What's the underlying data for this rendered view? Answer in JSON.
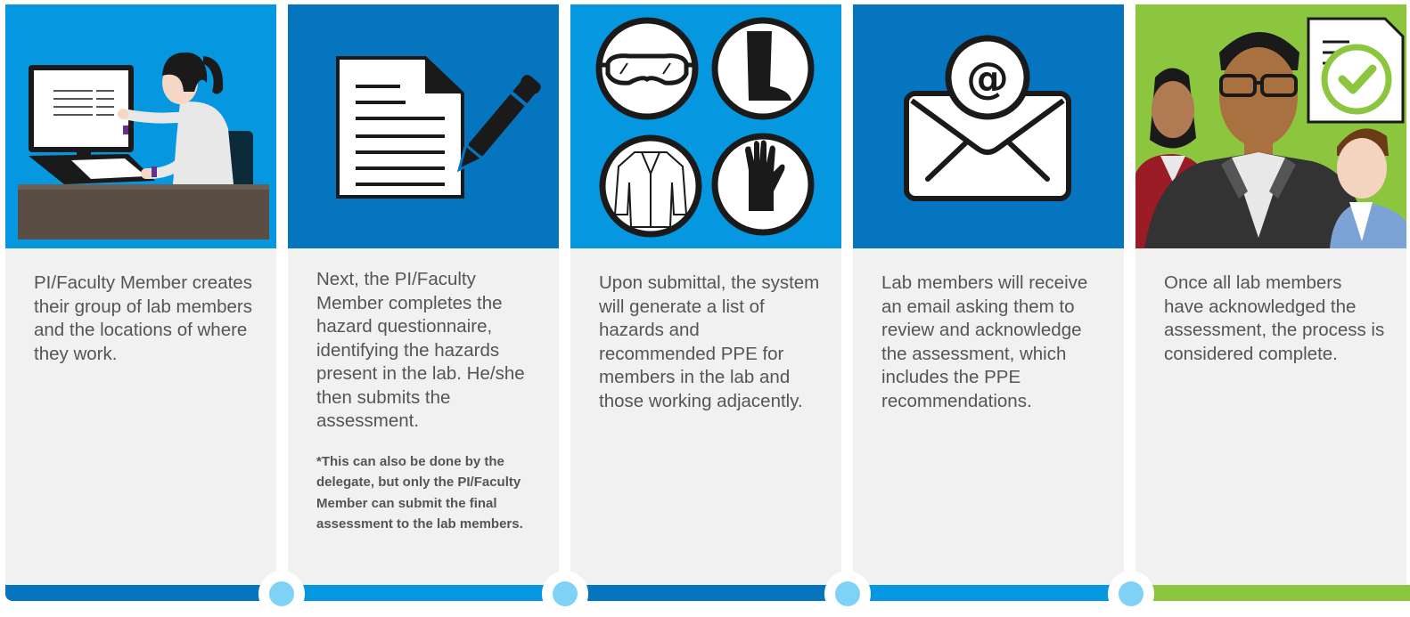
{
  "steps": [
    {
      "text": "PI/Faculty Member creates their group of lab members and the locations of where they work.",
      "icon": "scientist-at-computer-icon",
      "bg": "#0598e1"
    },
    {
      "text": "Next, the PI/Faculty Member completes the hazard questionnaire, identifying the hazards present in the lab. He/she then submits the assessment.",
      "note": "*This can also be done by the delegate, but only the PI/Faculty Member can submit the final assessment to the lab members.",
      "icon": "document-with-pen-icon",
      "bg": "#0675c0"
    },
    {
      "text": "Upon submittal, the system will generate a list of hazards and recommended PPE for members in the lab and those working adjacently.",
      "icon": "ppe-icons",
      "bg": "#0598e1"
    },
    {
      "text": "Lab members will receive an email asking them to review and acknowledge the assessment, which includes the PPE recommendations.",
      "icon": "email-envelope-icon",
      "bg": "#0675c0"
    },
    {
      "text": "Once all lab members have acknowledged the assessment, the process is considered complete.",
      "icon": "team-with-checked-document-icon",
      "bg": "#8cc63f"
    }
  ],
  "colors": {
    "blue_light": "#0598e1",
    "blue_dark": "#0675c0",
    "green": "#8cc63f",
    "panel": "#f1f1f1",
    "node": "#7dd2f6"
  }
}
